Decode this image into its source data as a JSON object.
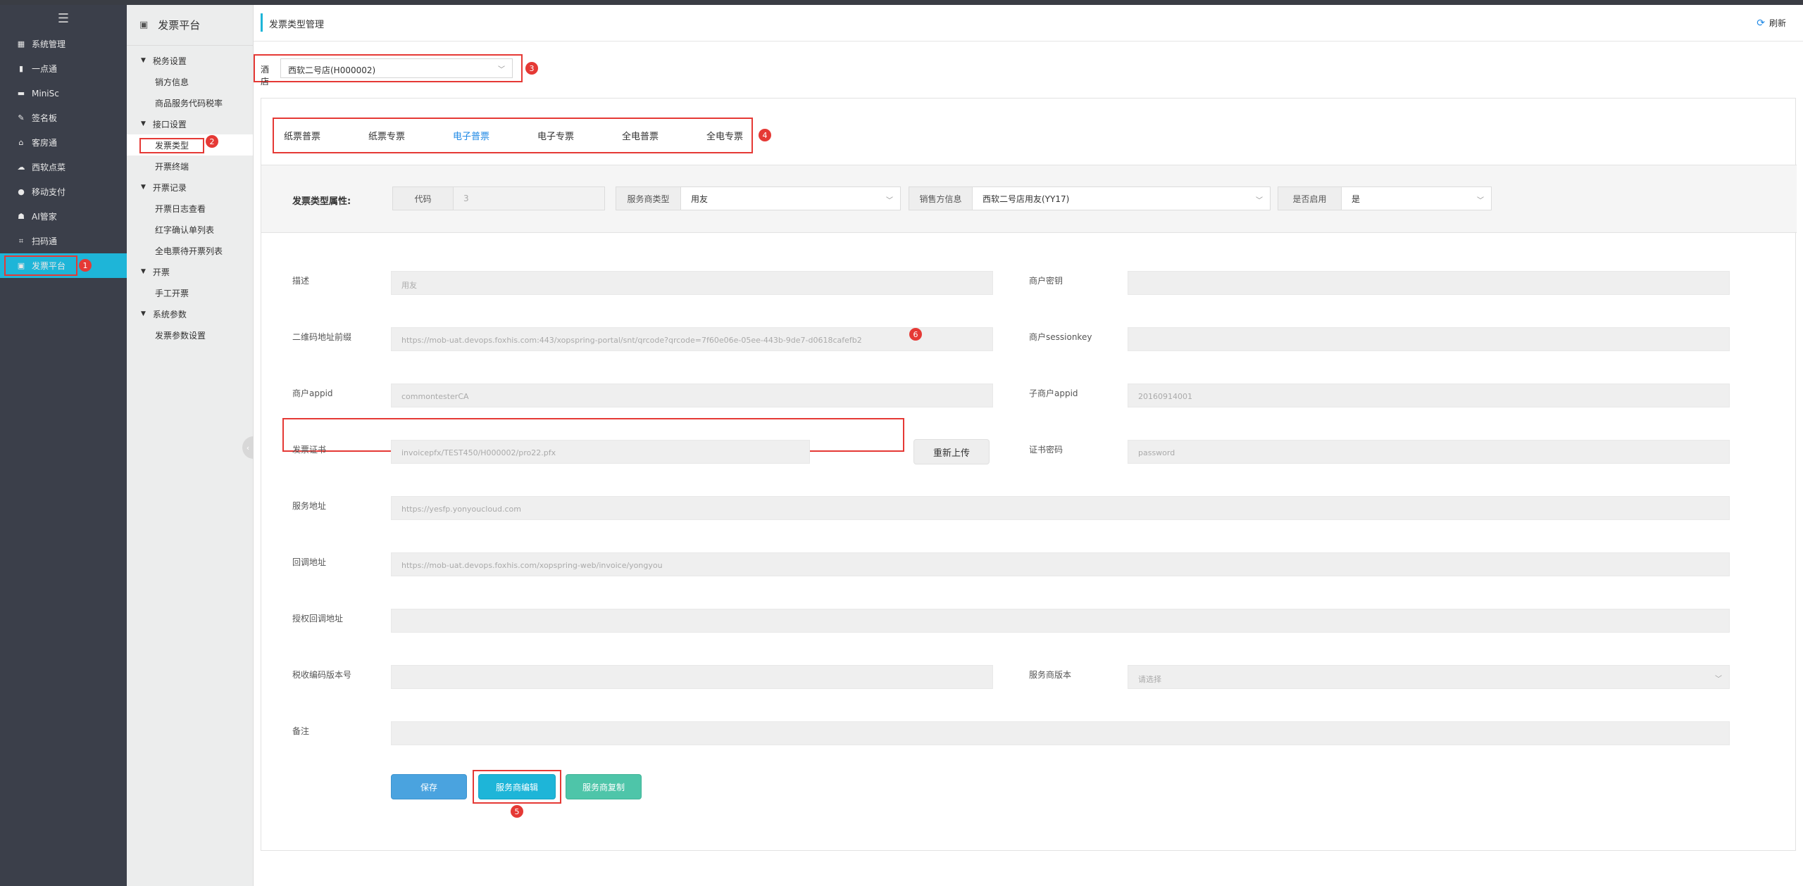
{
  "sidebar": {
    "items": [
      {
        "label": "系统管理",
        "icon": "grid-icon"
      },
      {
        "label": "一点通",
        "icon": "bar-chart-icon"
      },
      {
        "label": "MiniSc",
        "icon": "card-icon"
      },
      {
        "label": "签名板",
        "icon": "pen-icon"
      },
      {
        "label": "客房通",
        "icon": "home-icon"
      },
      {
        "label": "西软点菜",
        "icon": "cloud-icon"
      },
      {
        "label": "移动支付",
        "icon": "coin-icon"
      },
      {
        "label": "AI管家",
        "icon": "robot-icon"
      },
      {
        "label": "扫码通",
        "icon": "scan-icon"
      },
      {
        "label": "发票平台",
        "icon": "invoice-icon"
      }
    ]
  },
  "subnav": {
    "title": "发票平台",
    "groups": [
      {
        "label": "税务设置",
        "items": [
          "销方信息",
          "商品服务代码税率"
        ]
      },
      {
        "label": "接口设置",
        "items": [
          "发票类型",
          "开票终端"
        ]
      },
      {
        "label": "开票记录",
        "items": [
          "开票日志查看",
          "红字确认单列表",
          "全电票待开票列表"
        ]
      },
      {
        "label": "开票",
        "items": [
          "手工开票"
        ]
      },
      {
        "label": "系统参数",
        "items": [
          "发票参数设置"
        ]
      }
    ]
  },
  "header": {
    "title": "发票类型管理",
    "refresh": "刷新"
  },
  "hotel": {
    "label": "酒店",
    "value": "西软二号店(H000002)"
  },
  "tabs": [
    "纸票普票",
    "纸票专票",
    "电子普票",
    "电子专票",
    "全电普票",
    "全电专票"
  ],
  "attributes": {
    "title": "发票类型属性:",
    "code_label": "代码",
    "code_value": "3",
    "provider_type_label": "服务商类型",
    "provider_type_value": "用友",
    "seller_label": "销售方信息",
    "seller_value": "西软二号店用友(YY17)",
    "enabled_label": "是否启用",
    "enabled_value": "是"
  },
  "form": {
    "desc_label": "描述",
    "desc_value": "用友",
    "merchant_key_label": "商户密钥",
    "merchant_key_value": "",
    "qr_label": "二维码地址前缀",
    "qr_value": "https://mob-uat.devops.foxhis.com:443/xopspring-portal/snt/qrcode?qrcode=7f60e06e-05ee-443b-9de7-d0618cafefb2",
    "sessionkey_label": "商户sessionkey",
    "sessionkey_value": "",
    "appid_label": "商户appid",
    "appid_value": "commontesterCA",
    "sub_appid_label": "子商户appid",
    "sub_appid_value": "20160914001",
    "cert_label": "发票证书",
    "cert_value": "invoicepfx/TEST450/H000002/pro22.pfx",
    "reupload": "重新上传",
    "cert_pwd_label": "证书密码",
    "cert_pwd_value": "password",
    "service_url_label": "服务地址",
    "service_url_value": "https://yesfp.yonyoucloud.com",
    "callback_label": "回调地址",
    "callback_value": "https://mob-uat.devops.foxhis.com/xopspring-web/invoice/yongyou",
    "auth_callback_label": "授权回调地址",
    "auth_callback_value": "",
    "tax_code_label": "税收编码版本号",
    "tax_code_value": "",
    "provider_version_label": "服务商版本",
    "provider_version_placeholder": "请选择",
    "remark_label": "备注",
    "remark_value": ""
  },
  "buttons": {
    "save": "保存",
    "provider_edit": "服务商编辑",
    "provider_copy": "服务商复制"
  },
  "annotations": [
    "1",
    "2",
    "3",
    "4",
    "5",
    "6"
  ],
  "colors": {
    "accent": "#1eb5d8",
    "highlight": "#e53935",
    "sidebar": "#3b3f4a",
    "tab_active": "#1e88e5"
  }
}
